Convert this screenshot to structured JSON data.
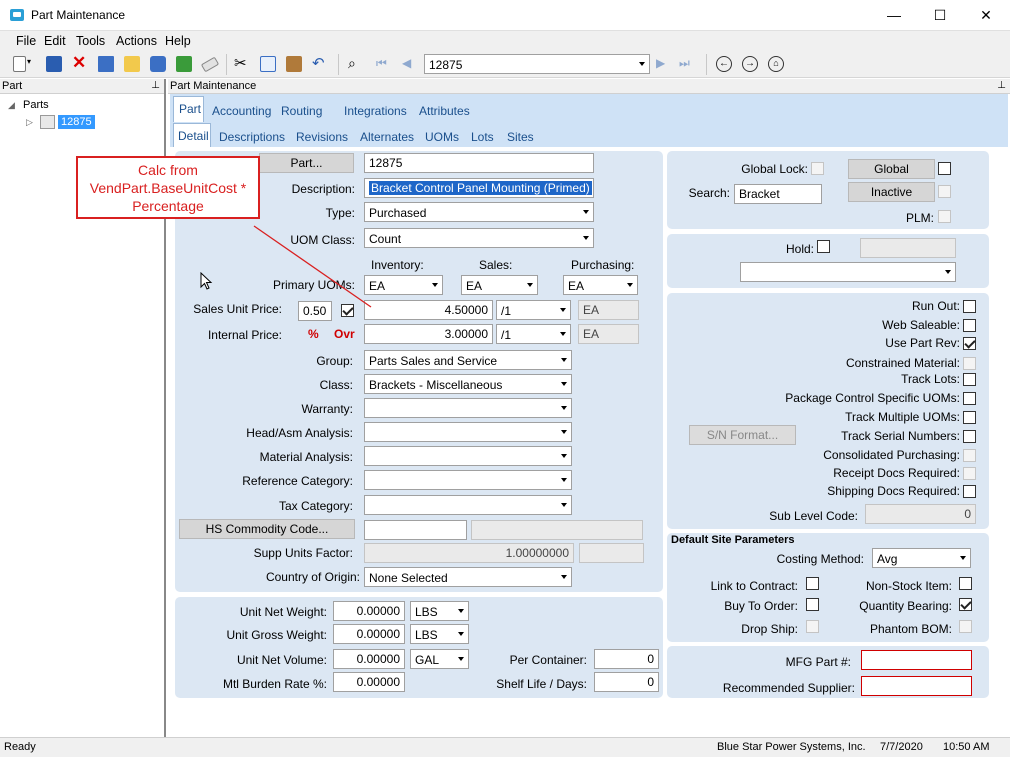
{
  "window": {
    "title": "Part Maintenance",
    "minimize": "—",
    "maximize": "☐",
    "close": "✕"
  },
  "menu": [
    "File",
    "Edit",
    "Tools",
    "Actions",
    "Help"
  ],
  "toolbar": {
    "part_number": "12875"
  },
  "left_panel": {
    "header": "Part",
    "tree_root": "Parts",
    "tree_item": "12875"
  },
  "right_panel": {
    "header": "Part Maintenance"
  },
  "tabs_top": [
    "Part",
    "Accounting",
    "Routing",
    "Integrations",
    "Attributes"
  ],
  "tabs_sub": [
    "Detail",
    "Descriptions",
    "Revisions",
    "Alternates",
    "UOMs",
    "Lots",
    "Sites"
  ],
  "callout": {
    "text": "Calc from VendPart.BaseUnitCost * Percentage",
    "color": "#d92020"
  },
  "form": {
    "part_button": "Part...",
    "part_value": "12875",
    "description_label": "Description:",
    "description_value": "Bracket Control Panel Mounting (Primed)",
    "type_label": "Type:",
    "type_value": "Purchased",
    "uom_class_label": "UOM Class:",
    "uom_class_value": "Count",
    "inventory_label": "Inventory:",
    "sales_label": "Sales:",
    "purchasing_label": "Purchasing:",
    "primary_uoms_label": "Primary UOMs:",
    "uom_inventory": "EA",
    "uom_sales": "EA",
    "uom_purchasing": "EA",
    "sales_unit_price_label": "Sales Unit Price:",
    "sales_unit_pct": "0.50",
    "sales_unit_price": "4.50000",
    "sales_per": "/1",
    "sales_uom": "EA",
    "internal_price_label": "Internal Price:",
    "pct_flag": "%",
    "ovr_flag": "Ovr",
    "internal_price": "3.00000",
    "internal_per": "/1",
    "internal_uom": "EA",
    "group_label": "Group:",
    "group_value": "Parts Sales and Service",
    "class_label": "Class:",
    "class_value": "Brackets - Miscellaneous",
    "warranty_label": "Warranty:",
    "head_asm_label": "Head/Asm Analysis:",
    "material_analysis_label": "Material Analysis:",
    "reference_category_label": "Reference Category:",
    "tax_category_label": "Tax Category:",
    "hs_commodity_button": "HS Commodity Code...",
    "supp_units_factor_label": "Supp Units Factor:",
    "supp_units_factor_value": "1.00000000",
    "country_of_origin_label": "Country of Origin:",
    "country_of_origin_value": "None Selected"
  },
  "weights": {
    "unit_net_weight_label": "Unit Net Weight:",
    "unit_net_weight": "0.00000",
    "unit_net_weight_uom": "LBS",
    "unit_gross_weight_label": "Unit Gross Weight:",
    "unit_gross_weight": "0.00000",
    "unit_gross_weight_uom": "LBS",
    "unit_net_volume_label": "Unit Net Volume:",
    "unit_net_volume": "0.00000",
    "unit_net_volume_uom": "GAL",
    "mtl_burden_label": "Mtl Burden Rate %:",
    "mtl_burden": "0.00000",
    "per_container_label": "Per Container:",
    "per_container": "0",
    "shelf_life_label": "Shelf Life / Days:",
    "shelf_life": "0"
  },
  "right": {
    "global_lock_label": "Global Lock:",
    "global_button": "Global",
    "inactive_button": "Inactive",
    "search_label": "Search:",
    "search_value": "Bracket",
    "plm_label": "PLM:",
    "hold_label": "Hold:",
    "sn_format_button": "S/N Format...",
    "flags": [
      {
        "label": "Run Out:",
        "checked": false,
        "disabled": false
      },
      {
        "label": "Web Saleable:",
        "checked": false,
        "disabled": false
      },
      {
        "label": "Use Part Rev:",
        "checked": true,
        "disabled": false
      },
      {
        "label": "Constrained Material:",
        "checked": false,
        "disabled": true
      },
      {
        "label": "Track Lots:",
        "checked": false,
        "disabled": false
      },
      {
        "label": "Package Control Specific UOMs:",
        "checked": false,
        "disabled": false
      },
      {
        "label": "Track Multiple UOMs:",
        "checked": false,
        "disabled": false
      },
      {
        "label": "Track Serial Numbers:",
        "checked": false,
        "disabled": false
      },
      {
        "label": "Consolidated Purchasing:",
        "checked": false,
        "disabled": true
      },
      {
        "label": "Receipt Docs Required:",
        "checked": false,
        "disabled": true
      },
      {
        "label": "Shipping Docs Required:",
        "checked": false,
        "disabled": false
      }
    ],
    "sub_level_code_label": "Sub Level Code:",
    "sub_level_code": "0",
    "default_site_header": "Default Site Parameters",
    "costing_method_label": "Costing Method:",
    "costing_method": "Avg",
    "link_to_contract_label": "Link to Contract:",
    "non_stock_item_label": "Non-Stock Item:",
    "buy_to_order_label": "Buy To Order:",
    "quantity_bearing_label": "Quantity Bearing:",
    "drop_ship_label": "Drop Ship:",
    "phantom_bom_label": "Phantom BOM:",
    "mfg_part_label": "MFG Part #:",
    "recommended_supplier_label": "Recommended Supplier:"
  },
  "status": {
    "left": "Ready",
    "company": "Blue Star Power Systems, Inc.",
    "date": "7/7/2020",
    "time": "10:50 AM"
  }
}
